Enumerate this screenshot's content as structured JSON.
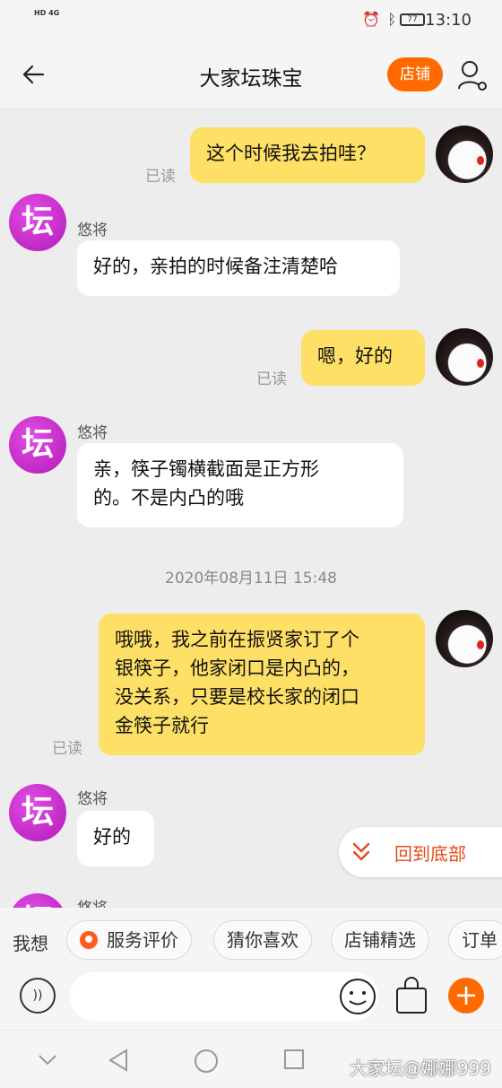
{
  "status_bar": {
    "left_text": "HD 4G",
    "battery": "77",
    "time": "13:10"
  },
  "header": {
    "title": "大家坛珠宝",
    "store_button": "店铺"
  },
  "messages": [
    {
      "from": "me",
      "text": "这个时候我去拍哇？",
      "read": "已读"
    },
    {
      "from": "shop",
      "sender": "悠将",
      "text": "好的，亲拍的时候备注清楚哈"
    },
    {
      "from": "me",
      "text": "嗯，好的",
      "read": "已读"
    },
    {
      "from": "shop",
      "sender": "悠将",
      "lines": [
        "亲，筷子镯横截面是正方形",
        "的。不是内凸的哦"
      ]
    },
    {
      "from": "me",
      "lines": [
        "哦哦，我之前在振贤家订了个",
        "银筷子，他家闭口是内凸的，",
        "没关系，只要是校长家的闭口",
        "金筷子就行"
      ],
      "read": "已读"
    },
    {
      "from": "shop",
      "sender": "悠将",
      "text": "好的"
    },
    {
      "from": "shop",
      "sender": "悠将"
    }
  ],
  "shop_avatar_glyph": "坛",
  "timestamp": "2020年08月11日 15:48",
  "jump_to_bottom": "回到底部",
  "quick_bar": {
    "label": "我想",
    "chips": [
      "服务评价",
      "猜你喜欢",
      "店铺精选",
      "订单"
    ]
  },
  "input": {
    "placeholder": ""
  },
  "watermark": "大家坛@娜娜999",
  "colors": {
    "accent": "#ff6a00",
    "bubble_out": "#ffe066",
    "bubble_in": "#ffffff",
    "background": "#ededed"
  }
}
